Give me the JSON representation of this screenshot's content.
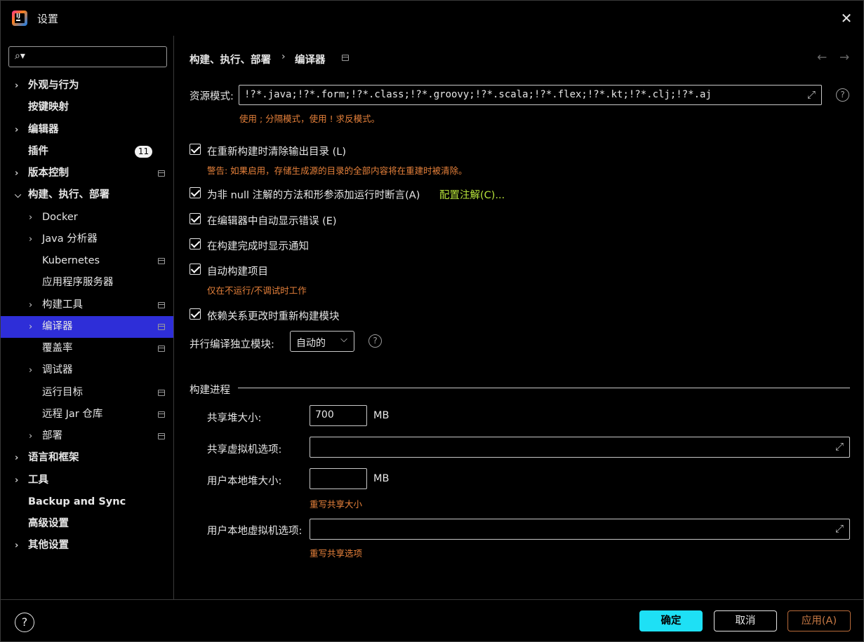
{
  "window": {
    "title": "设置"
  },
  "search": {
    "placeholder": ""
  },
  "sidebar": {
    "items": [
      {
        "label": "外观与行为",
        "chevron": true,
        "bold": true,
        "indent": 0
      },
      {
        "label": "按键映射",
        "chevron": false,
        "bold": true,
        "indent": 0
      },
      {
        "label": "编辑器",
        "chevron": true,
        "bold": true,
        "indent": 0
      },
      {
        "label": "插件",
        "chevron": false,
        "bold": true,
        "indent": 0,
        "badge": "11"
      },
      {
        "label": "版本控制",
        "chevron": true,
        "bold": true,
        "indent": 0,
        "proj": true
      },
      {
        "label": "构建、执行、部署",
        "chevron": true,
        "expanded": true,
        "bold": true,
        "indent": 0
      },
      {
        "label": "Docker",
        "chevron": true,
        "indent": 1
      },
      {
        "label": "Java 分析器",
        "chevron": true,
        "indent": 1
      },
      {
        "label": "Kubernetes",
        "chevron": false,
        "indent": 1,
        "proj": true
      },
      {
        "label": "应用程序服务器",
        "chevron": false,
        "indent": 1
      },
      {
        "label": "构建工具",
        "chevron": true,
        "indent": 1,
        "proj": true
      },
      {
        "label": "编译器",
        "chevron": true,
        "indent": 1,
        "proj": true,
        "selected": true
      },
      {
        "label": "覆盖率",
        "chevron": false,
        "indent": 1,
        "proj": true
      },
      {
        "label": "调试器",
        "chevron": true,
        "indent": 1
      },
      {
        "label": "运行目标",
        "chevron": false,
        "indent": 1,
        "proj": true
      },
      {
        "label": "远程 Jar 仓库",
        "chevron": false,
        "indent": 1,
        "proj": true
      },
      {
        "label": "部署",
        "chevron": true,
        "indent": 1,
        "proj": true
      },
      {
        "label": "语言和框架",
        "chevron": true,
        "bold": true,
        "indent": 0
      },
      {
        "label": "工具",
        "chevron": true,
        "bold": true,
        "indent": 0
      },
      {
        "label": "Backup and Sync",
        "chevron": false,
        "bold": true,
        "indent": 0
      },
      {
        "label": "高级设置",
        "chevron": false,
        "bold": true,
        "indent": 0
      },
      {
        "label": "其他设置",
        "chevron": true,
        "bold": true,
        "indent": 0
      }
    ]
  },
  "breadcrumb": {
    "parent": "构建、执行、部署",
    "sep": "›",
    "current": "编译器"
  },
  "nav": {
    "back": "←",
    "forward": "→"
  },
  "resource": {
    "label": "资源模式:",
    "value": "!?*.java;!?*.form;!?*.class;!?*.groovy;!?*.scala;!?*.flex;!?*.kt;!?*.clj;!?*.aj",
    "hint": "使用 ; 分隔模式，使用 ! 求反模式。"
  },
  "options": {
    "clear_output": {
      "label": "在重新构建时清除输出目录 (L)",
      "checked": true,
      "hint": "警告: 如果启用，存储生成源的目录的全部内容将在重建时被清除。"
    },
    "not_null": {
      "label": "为非 null 注解的方法和形参添加运行时断言(A)",
      "checked": true,
      "link": "配置注解(C)..."
    },
    "auto_show_errors": {
      "label": "在编辑器中自动显示错误 (E)",
      "checked": true
    },
    "show_notification": {
      "label": "在构建完成时显示通知",
      "checked": true
    },
    "auto_build": {
      "label": "自动构建项目",
      "checked": true,
      "hint": "仅在不运行/不调试时工作"
    },
    "rebuild_on_deps": {
      "label": "依赖关系更改时重新构建模块",
      "checked": true
    }
  },
  "parallel": {
    "label": "并行编译独立模块:",
    "value": "自动的"
  },
  "build_process": {
    "title": "构建进程",
    "shared_heap": {
      "label": "共享堆大小:",
      "value": "700",
      "unit": "MB"
    },
    "shared_vm": {
      "label": "共享虚拟机选项:",
      "value": ""
    },
    "user_heap": {
      "label": "用户本地堆大小:",
      "value": "",
      "unit": "MB",
      "hint": "重写共享大小"
    },
    "user_vm": {
      "label": "用户本地虚拟机选项:",
      "value": "",
      "hint": "重写共享选项"
    }
  },
  "footer": {
    "help": "?",
    "ok": "确定",
    "cancel": "取消",
    "apply": "应用(A)"
  },
  "colors": {
    "selection": "#2e2ed8",
    "hint": "#e5803a",
    "link": "#b7e33a",
    "primary": "#1ee0f5"
  }
}
